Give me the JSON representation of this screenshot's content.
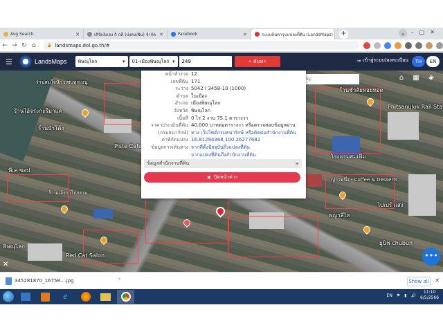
{
  "browser": {
    "tabs": [
      {
        "title": "Avg Search",
        "color": "#e8b13c"
      },
      {
        "title": "เสิร์ดงังเจง กิ กดี (ปงคงเฟิน) จำกัด",
        "color": "#777"
      },
      {
        "title": "Facebook",
        "color": "#1877f2"
      },
      {
        "title": "ระบบค้นหารูปแปลงที่ดิน (LandsMaps)",
        "color": "#d33"
      }
    ],
    "new_tab": "+",
    "url": "landsmaps.dol.go.th/#"
  },
  "app": {
    "hamburger": "☰",
    "brand": "LandsMaps",
    "province_select": "พิษณุโลก",
    "district_select": "01-เมืองพิษณุโลก",
    "parcel_number": "249",
    "search_label": "ค้นหา",
    "login_label": "เข้าสู่ระบบ/ลงทะเบียน",
    "lang_th": "TH",
    "lang_en": "EN"
  },
  "map": {
    "search_placeholder": "ค้นหาสถานที่สำคัญ",
    "labels": [
      "ร้านสมใจนึก แซ่บทุกเมนู",
      "ร้านไอ้จระกะรีมาแค",
      "ร้านป๋าโต้ง",
      "Piste Cafe",
      "พีเค ชอป",
      "ร้านแจ้งกาโกรงาน",
      "Red Cat Salon",
      "พิษณุโลก",
      "Phitsanulok Rail Station Night M",
      "โรงแรมสมเพิ่ม",
      "ญ่าวหนึ่ง - Coffee & Desserts",
      "พญาลิไท",
      "ไปเปร์ แสง",
      "ยูนิฟ chubun",
      "ร้านชัวลัยหอยทอด"
    ],
    "fab_label": "•••"
  },
  "popup": {
    "rows": [
      {
        "k": "หน้าสำรวจ",
        "v": "12"
      },
      {
        "k": "เลขที่ดิน",
        "v": "171"
      },
      {
        "k": "ระวาง",
        "v": "5042 I 3458-10 (1000)"
      },
      {
        "k": "ตำบล",
        "v": "ในเมือง"
      },
      {
        "k": "อำเภอ",
        "v": "เมืองพิษณุโลก"
      },
      {
        "k": "จังหวัด",
        "v": "พิษณุโลก"
      },
      {
        "k": "เนื้อที่",
        "v": "0 ไร่ 2 งาน 75.1 ตารางวา"
      },
      {
        "k": "ราคาประเมินที่ดิน",
        "v": "40,000 บาทต่อตารางวา หรือตรวจสอบข้อมูลผ่าน"
      },
      {
        "k": "(กรมธนารักษ์)",
        "v": "ทาง เว็บไซต์กรมธนารักษ์ หรือติดต่อสำนักงานที่ดิน",
        "link": true
      },
      {
        "k": "ค่าพิกัดแปลง",
        "v": "16.81294368,100.26277682",
        "link": true
      },
      {
        "k": "ข้อมูลการเดินทาง",
        "v": "จากที่ตั้งปัจจุบันถึงแปลงที่ดิน",
        "link": true
      },
      {
        "k": "",
        "v": "จากแปลงที่ดินถึงสำนักงานที่ดิน",
        "link": true
      }
    ],
    "section_label": "ข้อมูลสำนักงานที่ดิน",
    "section_toggle": "+",
    "close_label": "ปิดหน้าต่าง"
  },
  "downloads": {
    "file_name": "345281870_16758....jpg",
    "show_all": "Show all"
  },
  "taskbar": {
    "lang": "EN",
    "time": "11:10",
    "date": "6/5/2566"
  }
}
